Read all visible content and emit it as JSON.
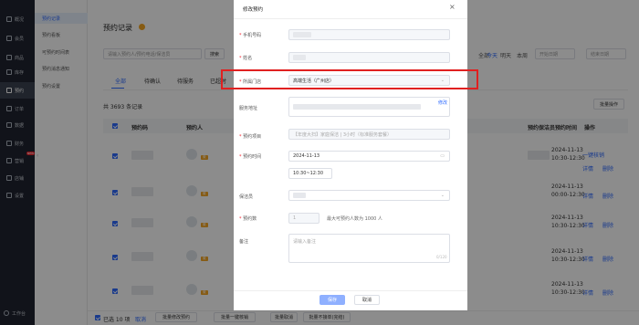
{
  "colors": {
    "accent": "#2f6bff",
    "sidebar": "#1f2430",
    "highlight": "#e02020",
    "tag": "#f5a623"
  },
  "nav": {
    "items": [
      {
        "label": "概况",
        "icon": "home-icon"
      },
      {
        "label": "会员",
        "icon": "user-icon"
      },
      {
        "label": "商品",
        "icon": "bag-icon"
      },
      {
        "label": "库存",
        "icon": "box-icon"
      },
      {
        "label": "预约",
        "icon": "calendar-icon"
      },
      {
        "label": "订单",
        "icon": "order-icon"
      },
      {
        "label": "数据",
        "icon": "chart-icon"
      },
      {
        "label": "财务",
        "icon": "wallet-icon"
      },
      {
        "label": "营销",
        "icon": "gift-icon",
        "badge": "NEW"
      },
      {
        "label": "店铺",
        "icon": "shop-icon"
      },
      {
        "label": "设置",
        "icon": "gear-icon"
      }
    ],
    "workspace": "工作台"
  },
  "subnav": {
    "items": [
      "预约记录",
      "预约看板",
      "可预约时间表",
      "预约消息通知",
      "预约设置"
    ]
  },
  "page": {
    "title": "预约记录",
    "search_placeholder": "请输入预约人/预约电话/保洁员",
    "search_button": "搜索",
    "date_filters": [
      "全部",
      "今天",
      "明天",
      "本周"
    ],
    "date_start_placeholder": "开始日期",
    "date_end_placeholder": "结束日期",
    "tabs": [
      "全部",
      "待确认",
      "待服务",
      "已超时"
    ],
    "total": "共 3693 条记录",
    "batch_button": "批量操作",
    "columns": [
      "预约码",
      "预约人",
      "预约保洁员",
      "预约时间",
      "操作"
    ],
    "rows": [
      {
        "tag": "微",
        "time1": "2024-11-13",
        "time2": "10:30-12:30",
        "actions": [
          "一键核销",
          "详情",
          "删除"
        ]
      },
      {
        "tag": "微",
        "time1": "2024-11-13",
        "time2": "00:00-12:30",
        "actions": [
          "详情",
          "删除"
        ]
      },
      {
        "tag": "微",
        "time1": "2024-11-13",
        "time2": "10:30-12:30",
        "actions": [
          "详情",
          "删除"
        ]
      },
      {
        "tag": "微",
        "time1": "2024-11-13",
        "time2": "10:30-12:30",
        "actions": [
          "详情",
          "删除"
        ]
      },
      {
        "tag": "微",
        "time1": "2024-11-13",
        "time2": "10:30-12:30",
        "actions": [
          "详情",
          "删除"
        ]
      }
    ],
    "footer": {
      "selected": "已选 10 项",
      "cancel": "取消",
      "buttons": [
        "批量修改预约",
        "批量一键核销",
        "批量取消",
        "批量不接单(完结)"
      ]
    }
  },
  "modal": {
    "title": "修改预约",
    "phone_label": "手机号码",
    "name_label": "姓名",
    "store_label": "所属门店",
    "store_value": "高端生活（广州店）",
    "address_label": "服务地址",
    "address_edit": "修改",
    "project_label": "预约项目",
    "project_value": "【年度大扫】家庭保洁 | 3小时（标准服务套餐）",
    "time_label": "预约时间",
    "date_value": "2024-11-13",
    "slot_value": "10:30~12:30",
    "cleaner_label": "保洁员",
    "count_label": "预约数",
    "count_value": "1",
    "count_hint": "最大可预约人数为 1000 人",
    "note_label": "备注",
    "note_placeholder": "请输入备注",
    "note_counter": "0/120",
    "save": "保存",
    "cancel": "取消"
  }
}
